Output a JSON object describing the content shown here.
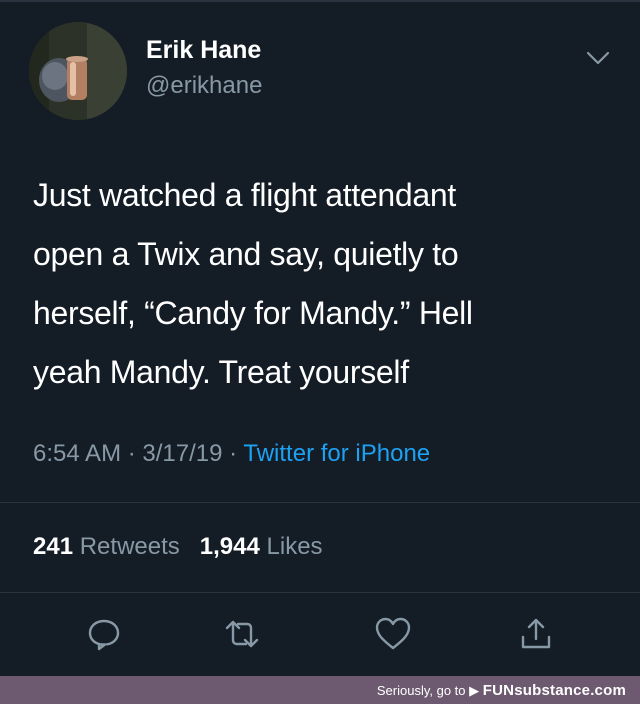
{
  "user": {
    "display_name": "Erik Hane",
    "handle": "@erikhane"
  },
  "tweet": {
    "lines": [
      "Just watched a flight attendant",
      "open a Twix and say, quietly to",
      "herself, “Candy for Mandy.” Hell",
      "yeah Mandy. Treat yourself"
    ],
    "time": "6:54 AM",
    "date": "3/17/19",
    "separator": "·",
    "source": "Twitter for iPhone"
  },
  "stats": {
    "retweets_count": "241",
    "retweets_label": "Retweets",
    "likes_count": "1,944",
    "likes_label": "Likes"
  },
  "icons": {
    "menu": "chevron-down-icon",
    "reply": "reply-icon",
    "retweet": "retweet-icon",
    "like": "heart-icon",
    "share": "share-icon"
  },
  "footer": {
    "prefix": "Seriously, go to",
    "brand": "FUNsubstance.com"
  },
  "colors": {
    "background": "#141c26",
    "primary_text": "#ffffff",
    "secondary_text": "#8899a6",
    "link": "#1da1f2",
    "footer_bar": "#6d5a70"
  }
}
